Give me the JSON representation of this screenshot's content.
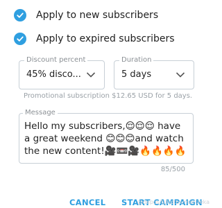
{
  "options": [
    {
      "label": "Apply to new subscribers",
      "checked": true
    },
    {
      "label": "Apply to expired subscribers",
      "checked": true
    }
  ],
  "discount": {
    "legend": "Discount percent",
    "value": "45% disco..."
  },
  "duration": {
    "legend": "Duration",
    "value": "5 days"
  },
  "hint": "Promotional subscription $12.65 USD for 5 days.",
  "message": {
    "legend": "Message",
    "text": "Hello my subscribers,😌😌😌 have a great weekend 😊😊😊and watch the new content!🎥📼🎥🔥🔥🔥🔥"
  },
  "counter": "85/500",
  "buttons": {
    "cancel": "CANCEL",
    "start": "START CAMPAIGN"
  },
  "watermark": "@depositphotos/marizeka",
  "colors": {
    "accent": "#2f9fe0",
    "border": "#c7cfd6"
  }
}
